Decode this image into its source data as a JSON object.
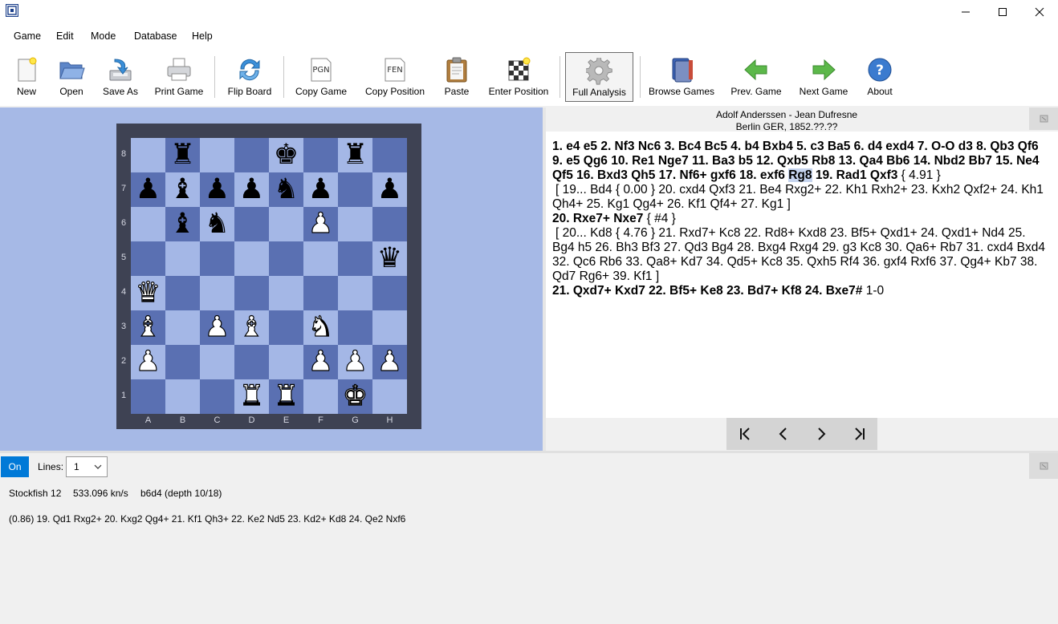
{
  "menu": [
    "Game",
    "Edit",
    "Mode",
    "Database",
    "Help"
  ],
  "toolbar": {
    "new": "New",
    "open": "Open",
    "save_as": "Save As",
    "print_game": "Print Game",
    "flip_board": "Flip Board",
    "copy_game": "Copy Game",
    "copy_position": "Copy Position",
    "paste": "Paste",
    "enter_position": "Enter Position",
    "full_analysis": "Full Analysis",
    "browse_games": "Browse Games",
    "prev_game": "Prev. Game",
    "next_game": "Next Game",
    "about": "About",
    "pgn_icon_text": "PGN",
    "fen_icon_text": "FEN"
  },
  "board": {
    "rank_labels": [
      "8",
      "7",
      "6",
      "5",
      "4",
      "3",
      "2",
      "1"
    ],
    "file_labels": [
      "A",
      "B",
      "C",
      "D",
      "E",
      "F",
      "G",
      "H"
    ],
    "rows": [
      [
        "",
        "♜",
        "",
        "",
        "♚",
        "",
        "♜",
        ""
      ],
      [
        "♟",
        "♝",
        "♟",
        "♟",
        "♞",
        "♟",
        "",
        "♟"
      ],
      [
        "",
        "♝",
        "♞",
        "",
        "",
        "♙",
        "",
        ""
      ],
      [
        "",
        "",
        "",
        "",
        "",
        "",
        "",
        "♛"
      ],
      [
        "♕",
        "",
        "",
        "",
        "",
        "",
        "",
        ""
      ],
      [
        "♗",
        "",
        "♙",
        "♗",
        "",
        "♘",
        "",
        ""
      ],
      [
        "♙",
        "",
        "",
        "",
        "",
        "♙",
        "♙",
        "♙"
      ],
      [
        "",
        "",
        "",
        "♖",
        "♖",
        "",
        "♔",
        ""
      ]
    ],
    "colors": {
      "light": "#a4b7e6",
      "dark": "#5a70b2",
      "frame": "#3e4253"
    }
  },
  "game": {
    "players": "Adolf Anderssen - Jean Dufresne",
    "event": "Berlin GER, 1852.??.??"
  },
  "notation": {
    "line1_main": "1. e4 e5 2. Nf3 Nc6 3. Bc4 Bc5 4. b4 Bxb4 5. c3 Ba5 6. d4 exd4 7. O-O d3 8. Qb3 Qf6 9. e5 Qg6 10. Re1 Nge7 11. Ba3 b5 12. Qxb5 Rb8 13. Qa4 Bb6 14. Nbd2 Bb7 15. Ne4 Qf5 16. Bxd3 Qh5 17. Nf6+ gxf6 18. exf6",
    "selected_move": "Rg8",
    "line1_after": "19. Rad1 Qxf3",
    "line1_comment": "{ 4.91 }",
    "variation1": "[ 19... Bd4 { 0.00 } 20. cxd4 Qxf3 21. Be4 Rxg2+ 22. Kh1 Rxh2+ 23. Kxh2 Qxf2+ 24. Kh1 Qh4+ 25. Kg1 Qg4+ 26. Kf1 Qf4+ 27. Kg1 ]",
    "line2_main": "20. Rxe7+ Nxe7",
    "line2_comment": "{ #4 }",
    "variation2": "[ 20... Kd8 { 4.76 } 21. Rxd7+ Kc8 22. Rd8+ Kxd8 23. Bf5+ Qxd1+ 24. Qxd1+ Nd4 25. Bg4 h5 26. Bh3 Bf3 27. Qd3 Bg4 28. Bxg4 Rxg4 29. g3 Kc8 30. Qa6+ Rb7 31. cxd4 Bxd4 32. Qc6 Rb6 33. Qa8+ Kd7 34. Qd5+ Kc8 35. Qxh5 Rf4 36. gxf4 Rxf6 37. Qg4+ Kb7 38. Qd7 Rg6+ 39. Kf1 ]",
    "line3_main": "21. Qxd7+ Kxd7 22. Bf5+ Ke8 23. Bd7+ Kf8 24. Bxe7#",
    "result": "1-0"
  },
  "navigation": {
    "first": "|<",
    "prev": "<",
    "next": ">",
    "last": ">|"
  },
  "engine": {
    "on_label": "On",
    "lines_label": "Lines:",
    "lines_value": "1",
    "name": "Stockfish 12",
    "speed": "533.096 kn/s",
    "current": "b6d4 (depth 10/18)",
    "line": "(0.86)  19. Qd1 Rxg2+ 20. Kxg2 Qg4+ 21. Kf1 Qh3+ 22. Ke2 Nd5 23. Kd2+ Kd8 24. Qe2 Nxf6"
  },
  "colors": {
    "accent": "#0079d7",
    "board_background": "#a6b9e6"
  }
}
